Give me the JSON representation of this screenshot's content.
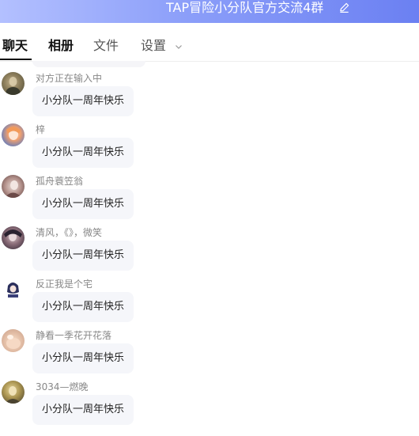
{
  "header": {
    "title": "TAP冒险小分队官方交流4群",
    "edit_icon": "edit-icon"
  },
  "tabs": [
    {
      "label": "聊天",
      "active": true
    },
    {
      "label": "相册"
    },
    {
      "label": "文件"
    },
    {
      "label": "设置",
      "icon": "chevron-down-icon"
    }
  ],
  "messages": [
    {
      "name": "对方正在输入中",
      "text": "小分队一周年快乐"
    },
    {
      "name": "梓",
      "text": "小分队一周年快乐"
    },
    {
      "name": "孤舟蓑笠翁",
      "text": "小分队一周年快乐"
    },
    {
      "name": "清风，《》，微笑",
      "text": "小分队一周年快乐"
    },
    {
      "name": "反正我是个宅",
      "text": "小分队一周年快乐"
    },
    {
      "name": "静看一季花开花落",
      "text": "小分队一周年快乐"
    },
    {
      "name": "3034—燃晚",
      "text": "小分队一周年快乐"
    }
  ]
}
